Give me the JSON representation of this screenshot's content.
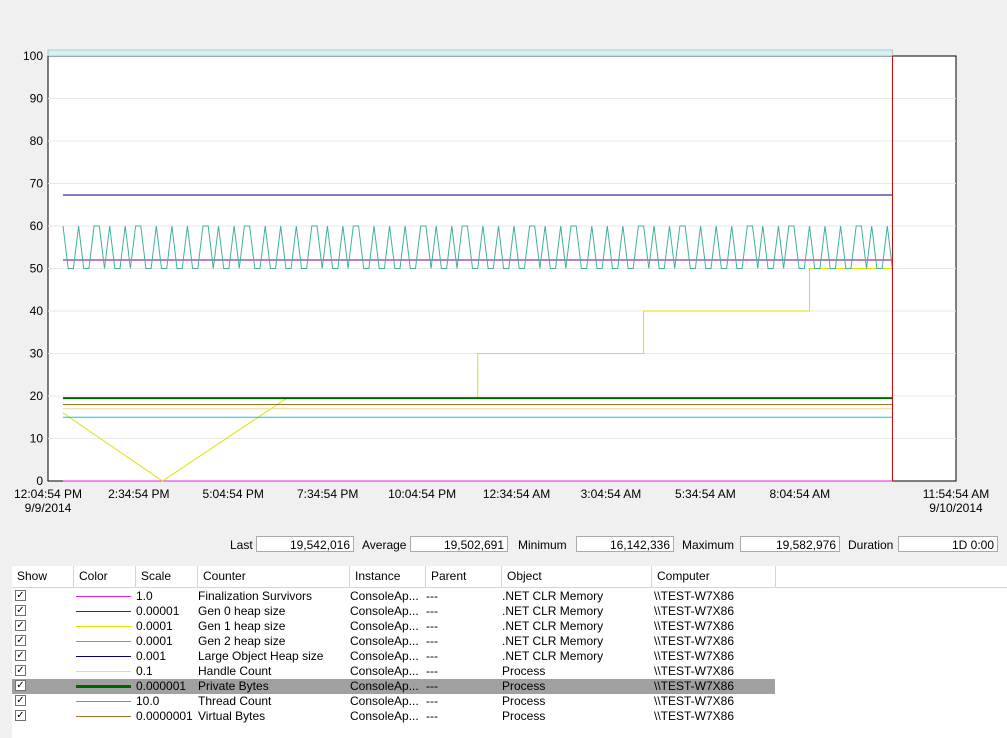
{
  "chart_data": {
    "type": "line",
    "ylim": [
      0,
      100
    ],
    "y_ticks": [
      "100",
      "90",
      "80",
      "70",
      "60",
      "50",
      "40",
      "30",
      "20",
      "10",
      "0"
    ],
    "x_ticks": [
      {
        "line1": "12:04:54 PM",
        "line2": "9/9/2014"
      },
      {
        "line1": "2:34:54 PM",
        "line2": ""
      },
      {
        "line1": "5:04:54 PM",
        "line2": ""
      },
      {
        "line1": "7:34:54 PM",
        "line2": ""
      },
      {
        "line1": "10:04:54 PM",
        "line2": ""
      },
      {
        "line1": "12:34:54 AM",
        "line2": ""
      },
      {
        "line1": "3:04:54 AM",
        "line2": ""
      },
      {
        "line1": "5:34:54 AM",
        "line2": ""
      },
      {
        "line1": "8:04:54 AM",
        "line2": ""
      },
      {
        "line1": "11:54:54 AM",
        "line2": "9/10/2014"
      }
    ],
    "grid": true,
    "series": [
      {
        "name": "Finalization Survivors",
        "color": "#e020e0",
        "style": "flat",
        "level": 0
      },
      {
        "name": "Gen 0 heap size",
        "color": "#800080",
        "style": "flat",
        "level": 52
      },
      {
        "name": "Gen 1 heap size",
        "color": "#e0e000",
        "style": "step",
        "steps": [
          [
            0,
            16
          ],
          [
            0.12,
            0
          ],
          [
            0.27,
            19.5
          ],
          [
            0.5,
            19.5
          ],
          [
            0.5,
            30
          ],
          [
            0.7,
            30
          ],
          [
            0.7,
            40
          ],
          [
            0.9,
            40
          ],
          [
            0.9,
            50
          ],
          [
            1.0,
            50
          ]
        ]
      },
      {
        "name": "Gen 2 heap size",
        "color": "#00d0d0",
        "style": "flat",
        "level": 15
      },
      {
        "name": "Large Object Heap size",
        "color": "#000080",
        "style": "flat",
        "level": 67.3
      },
      {
        "name": "Handle Count",
        "color": "#f0d890",
        "style": "flat",
        "level": 17
      },
      {
        "name": "Private Bytes",
        "color": "#006400",
        "style": "flat",
        "level": 19.5
      },
      {
        "name": "Thread Count",
        "color": "#40b0a0",
        "style": "spiky",
        "level": 50,
        "peak": 60
      },
      {
        "name": "Virtual Bytes",
        "color": "#a07020",
        "style": "flat",
        "level": 18
      }
    ]
  },
  "stats": {
    "last_label": "Last",
    "last_value": "19,542,016",
    "average_label": "Average",
    "average_value": "19,502,691",
    "minimum_label": "Minimum",
    "minimum_value": "16,142,336",
    "maximum_label": "Maximum",
    "maximum_value": "19,582,976",
    "duration_label": "Duration",
    "duration_value": "1D 0:00"
  },
  "table": {
    "headers": [
      "Show",
      "Color",
      "Scale",
      "Counter",
      "Instance",
      "Parent",
      "Object",
      "Computer"
    ],
    "rows": [
      {
        "color": "#e020e0",
        "scale": "1.0",
        "counter": "Finalization Survivors",
        "instance": "ConsoleAp...",
        "parent": "---",
        "object": ".NET CLR Memory",
        "computer": "\\\\TEST-W7X86"
      },
      {
        "color": "#800080",
        "scale": "0.00001",
        "counter": "Gen 0 heap size",
        "instance": "ConsoleAp...",
        "parent": "---",
        "object": ".NET CLR Memory",
        "computer": "\\\\TEST-W7X86"
      },
      {
        "color": "#e0e000",
        "scale": "0.0001",
        "counter": "Gen 1 heap size",
        "instance": "ConsoleAp...",
        "parent": "---",
        "object": ".NET CLR Memory",
        "computer": "\\\\TEST-W7X86"
      },
      {
        "color": "#00d0d0",
        "scale": "0.0001",
        "counter": "Gen 2 heap size",
        "instance": "ConsoleAp...",
        "parent": "---",
        "object": ".NET CLR Memory",
        "computer": "\\\\TEST-W7X86"
      },
      {
        "color": "#000080",
        "scale": "0.001",
        "counter": "Large Object Heap size",
        "instance": "ConsoleAp...",
        "parent": "---",
        "object": ".NET CLR Memory",
        "computer": "\\\\TEST-W7X86"
      },
      {
        "color": "#f0d890",
        "scale": "0.1",
        "counter": "Handle Count",
        "instance": "ConsoleAp...",
        "parent": "---",
        "object": "Process",
        "computer": "\\\\TEST-W7X86"
      },
      {
        "color": "#006400",
        "scale": "0.000001",
        "counter": "Private Bytes",
        "instance": "ConsoleAp...",
        "parent": "---",
        "object": "Process",
        "computer": "\\\\TEST-W7X86"
      },
      {
        "color": "#40b0a0",
        "scale": "10.0",
        "counter": "Thread Count",
        "instance": "ConsoleAp...",
        "parent": "---",
        "object": "Process",
        "computer": "\\\\TEST-W7X86"
      },
      {
        "color": "#a07020",
        "scale": "0.0000001",
        "counter": "Virtual Bytes",
        "instance": "ConsoleAp...",
        "parent": "---",
        "object": "Process",
        "computer": "\\\\TEST-W7X86"
      }
    ],
    "selected_row": 6
  }
}
